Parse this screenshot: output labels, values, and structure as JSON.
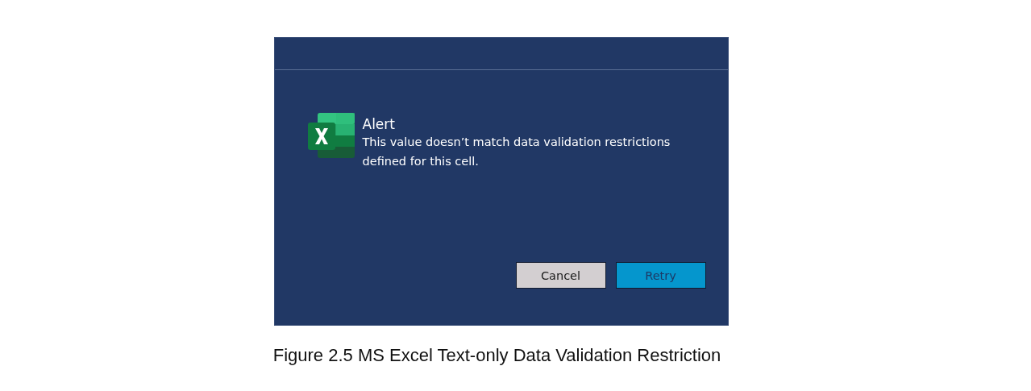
{
  "dialog": {
    "title": "Alert",
    "message": "This value doesn’t match data validation restrictions defined for this cell.",
    "buttons": [
      {
        "label": "Cancel",
        "kind": "secondary"
      },
      {
        "label": "Retry",
        "kind": "primary"
      }
    ]
  },
  "caption": "Figure 2.5 MS Excel Text-only Data Validation Restriction"
}
